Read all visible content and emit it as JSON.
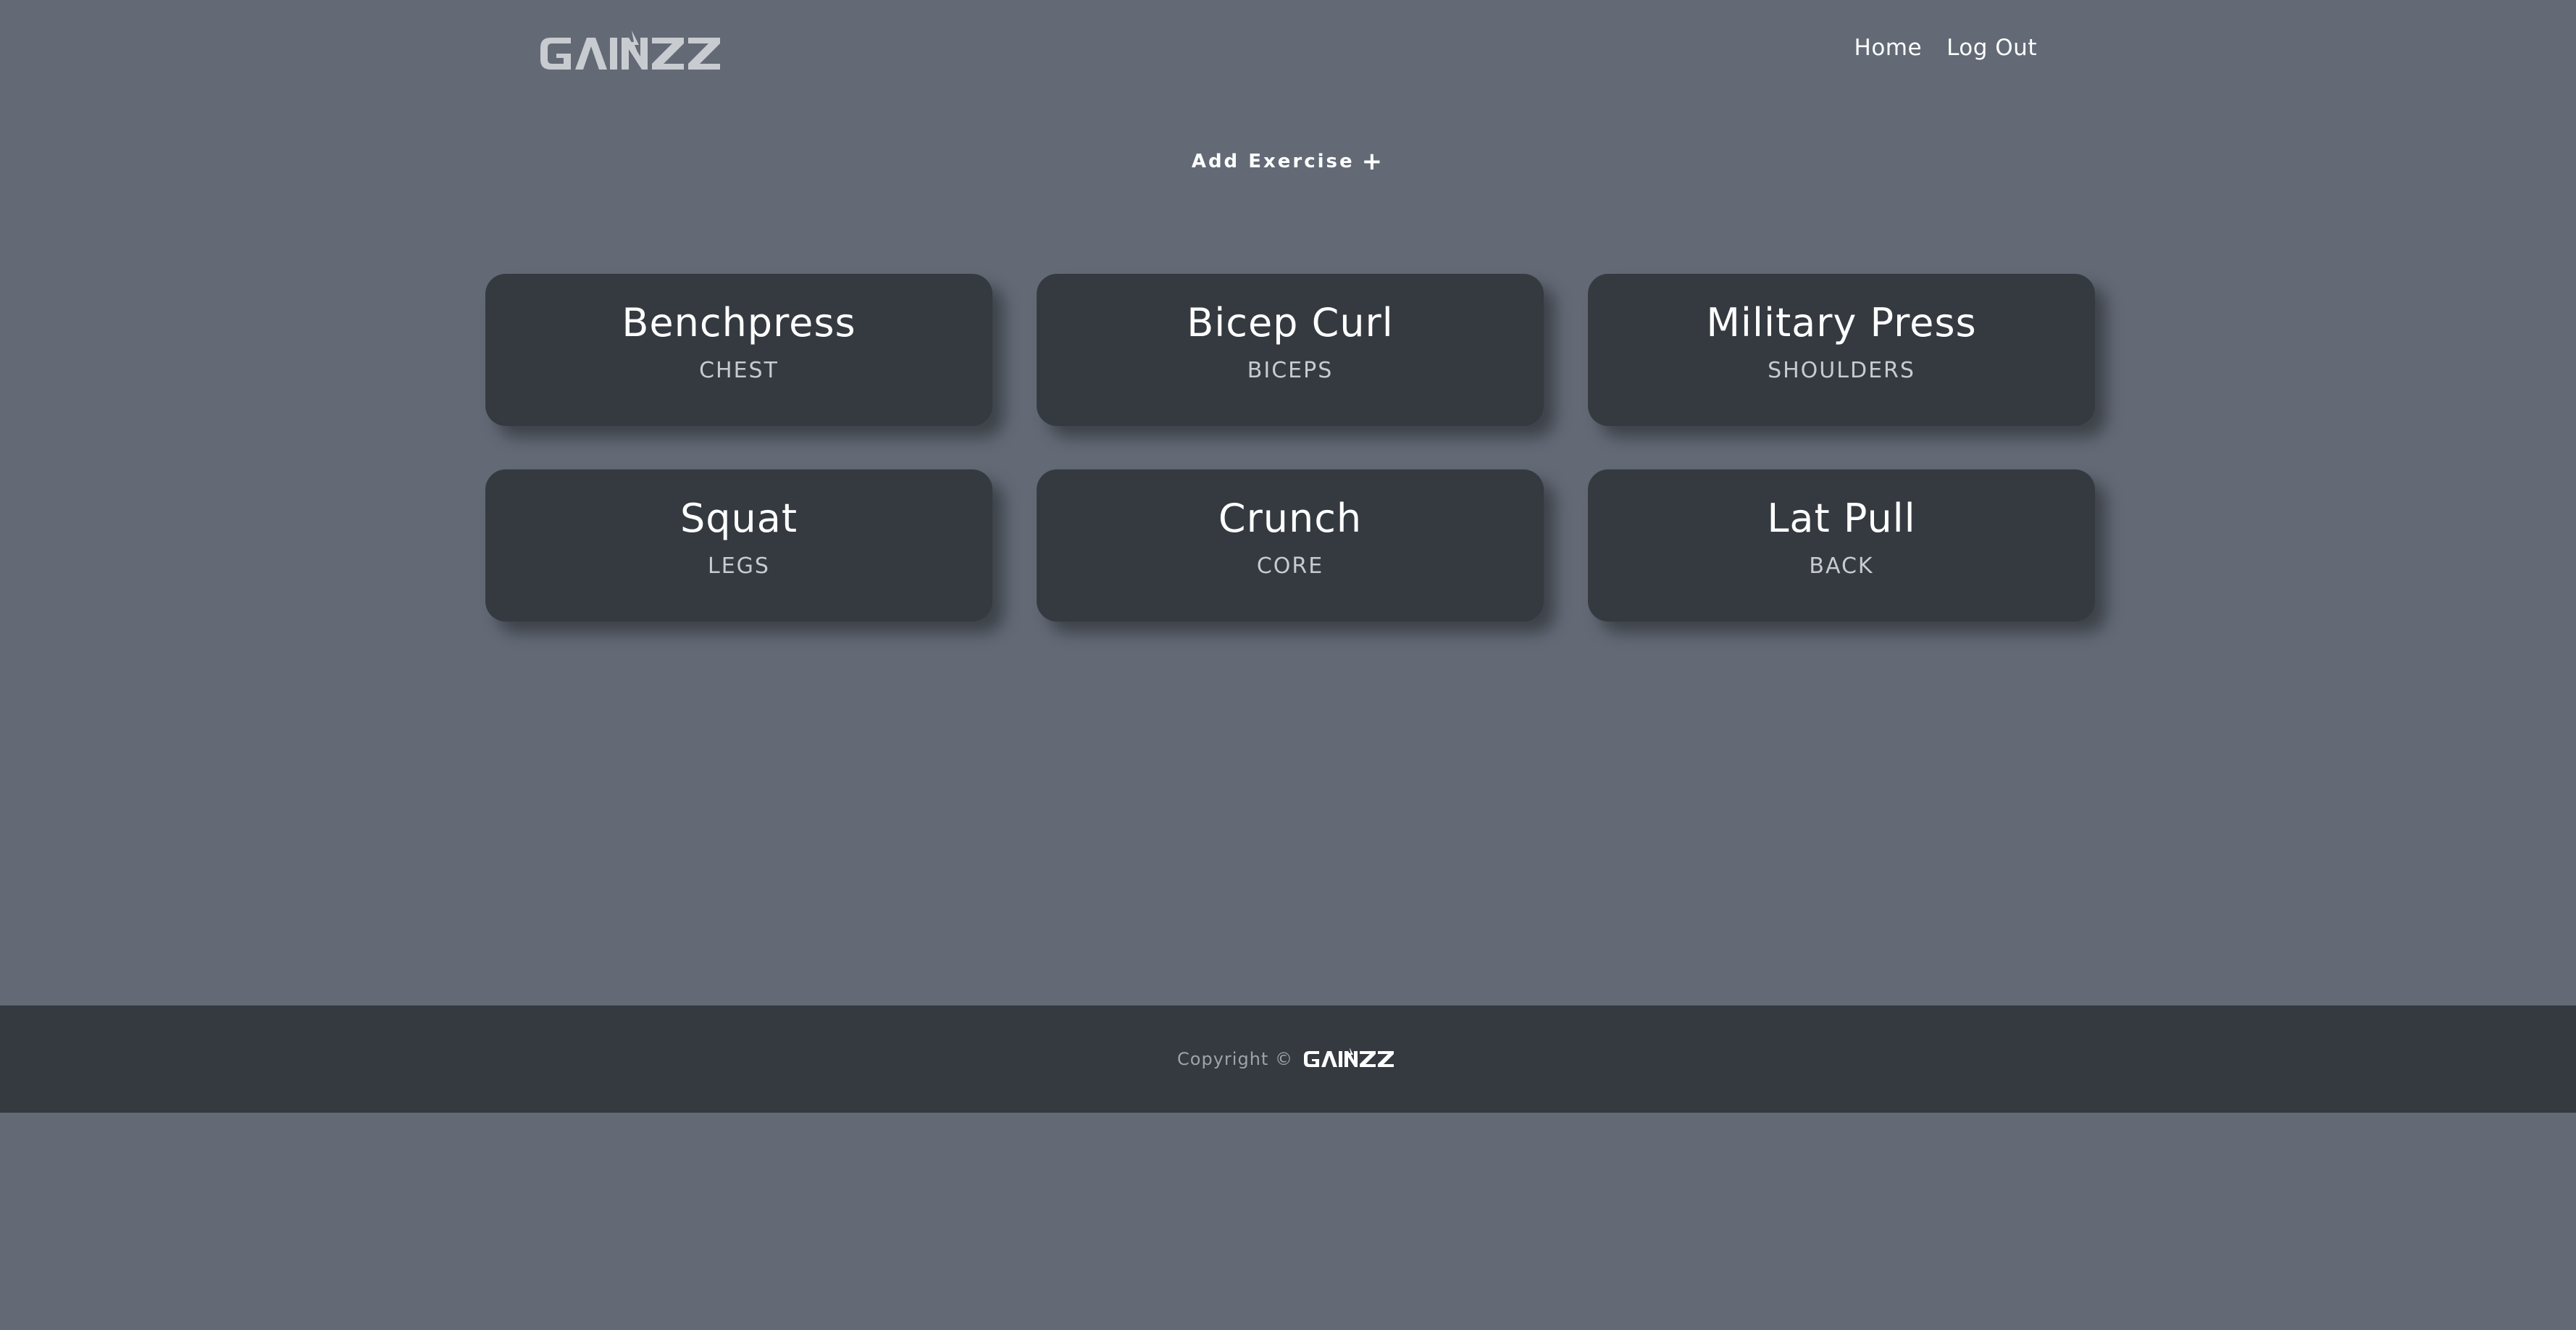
{
  "header": {
    "logo_text": "GAINZZ",
    "nav": [
      {
        "label": "Home"
      },
      {
        "label": "Log Out"
      }
    ]
  },
  "actions": {
    "add_exercise_label": "Add Exercise",
    "add_icon": "plus-icon"
  },
  "exercises": [
    {
      "name": "Benchpress",
      "muscle": "CHEST"
    },
    {
      "name": "Bicep Curl",
      "muscle": "BICEPS"
    },
    {
      "name": "Military Press",
      "muscle": "SHOULDERS"
    },
    {
      "name": "Squat",
      "muscle": "LEGS"
    },
    {
      "name": "Crunch",
      "muscle": "CORE"
    },
    {
      "name": "Lat Pull",
      "muscle": "BACK"
    }
  ],
  "footer": {
    "copyright": "Copyright ©",
    "logo_text": "GAINZZ"
  },
  "colors": {
    "page_background": "#636a76",
    "card_background": "#343a40",
    "footer_background": "#343a40",
    "logo_header": "#c8cbd0",
    "text_primary": "#ffffff",
    "text_secondary": "#c7cbd1"
  }
}
